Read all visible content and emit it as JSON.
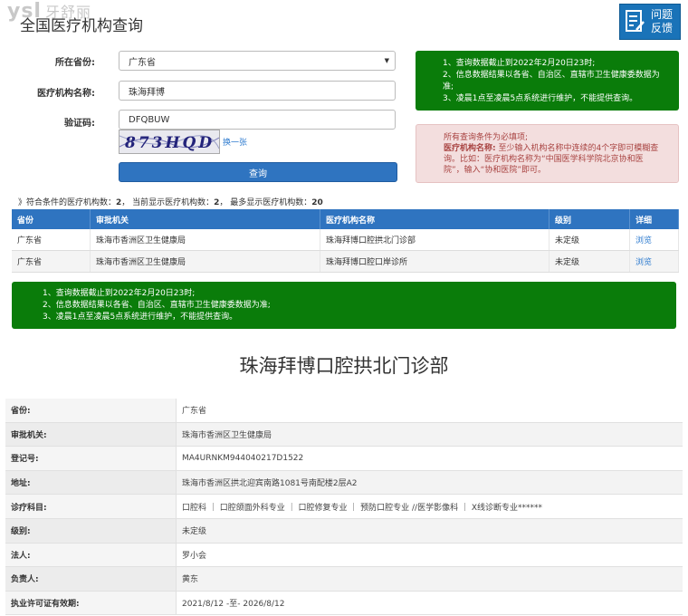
{
  "watermark": {
    "latin": "ysl",
    "cn": "牙舒丽"
  },
  "title": "全国医疗机构查询",
  "feedback": {
    "line1": "问题",
    "line2": "反馈",
    "icon": "edit-question-icon"
  },
  "form": {
    "province_label": "所在省份:",
    "province_value": "广东省",
    "name_label": "医疗机构名称:",
    "name_value": "珠海拜博",
    "captcha_label": "验证码:",
    "captcha_value": "DFQBUW",
    "captcha_image_text": "873HQD",
    "refresh_label": "换一张",
    "submit_label": "查询"
  },
  "notice": [
    "1、查询数据截止到2022年2月20日23时;",
    "2、信息数据结果以各省、自治区、直辖市卫生健康委数据为准;",
    "3、凌晨1点至凌晨5点系统进行维护，不能提供查询。"
  ],
  "notice_wrapped": [
    "1、查询数据截止到2022年2月20日23时;",
    "2、信息数据结果以各省、自治区、直辖市卫生健康委数据为",
    "准;",
    "3、凌晨1点至凌晨5点系统进行维护，不能提供查询。"
  ],
  "requirement": {
    "line1": "所有查询条件为必填项;",
    "label": "医疗机构名称:",
    "line2": " 至少输入机构名称中连续的4个字即可模糊查",
    "line3": "询。比如：医疗机构名称为“中国医学科学院北京协和医",
    "line4": "院”，输入“协和医院”即可。"
  },
  "summary": {
    "prefix": "》符合条件的医疗机构数：",
    "match_count": "2",
    "mid": "， 当前显示医疗机构数：",
    "shown_count": "2",
    "mid2": "， 最多显示医疗机构数：",
    "max_count": "20"
  },
  "results": {
    "headers": [
      "省份",
      "审批机关",
      "医疗机构名称",
      "级别",
      "详细"
    ],
    "rows": [
      [
        "广东省",
        "珠海市香洲区卫生健康局",
        "珠海拜博口腔拱北门诊部",
        "未定级",
        "浏览"
      ],
      [
        "广东省",
        "珠海市香洲区卫生健康局",
        "珠海拜博口腔口岸诊所",
        "未定级",
        "浏览"
      ]
    ]
  },
  "detail": {
    "title": "珠海拜博口腔拱北门诊部",
    "rows": [
      [
        "省份:",
        "广东省"
      ],
      [
        "审批机关:",
        "珠海市香洲区卫生健康局"
      ],
      [
        "登记号:",
        "MA4URNKM944040217D1522"
      ],
      [
        "地址:",
        "珠海市香洲区拱北迎宾南路1081号南配楼2层A2"
      ],
      [
        "诊疗科目:",
        "口腔科 ｜ 口腔颌面外科专业 ｜ 口腔修复专业 ｜ 预防口腔专业 //医学影像科 ｜ X线诊断专业******"
      ],
      [
        "级别:",
        "未定级"
      ],
      [
        "法人:",
        "罗小会"
      ],
      [
        "负责人:",
        "黄东"
      ],
      [
        "执业许可证有效期:",
        "2021/8/12 -至- 2026/8/12"
      ]
    ]
  },
  "colors": {
    "primary": "#2f74c0",
    "notice_green": "#0a7c0a",
    "warning_bg": "#f3dede",
    "warning_text": "#a94442"
  }
}
